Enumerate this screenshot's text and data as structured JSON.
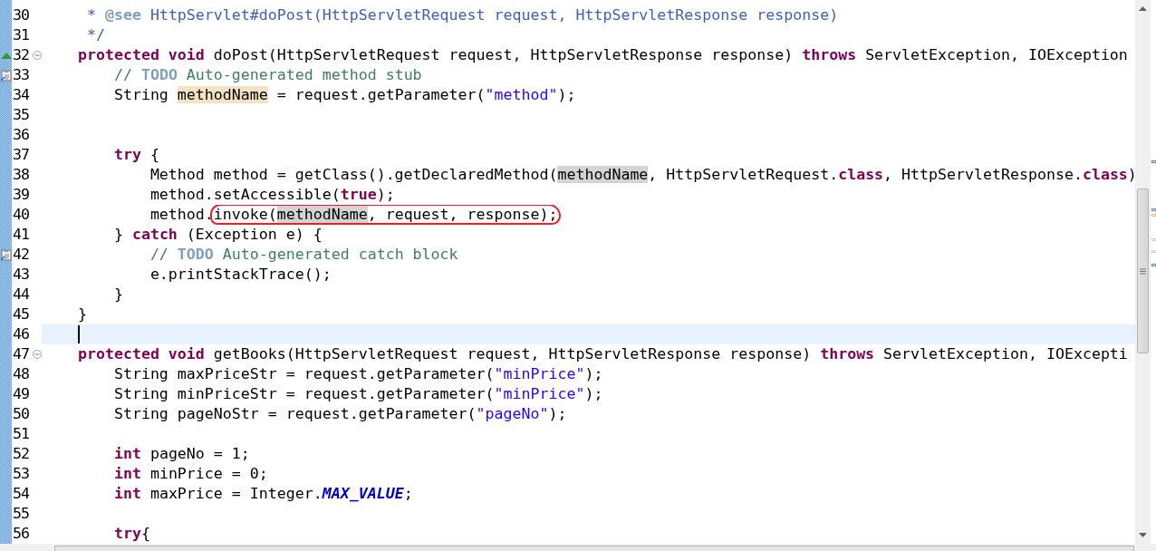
{
  "editor": {
    "lines": [
      {
        "number": "30",
        "kind": "code",
        "tokens": [
          {
            "kind": "doc",
            "text": "     * "
          },
          {
            "kind": "doctag",
            "text": "@see"
          },
          {
            "kind": "doc",
            "text": " HttpServlet#doPost(HttpServletRequest request, HttpServletResponse response)"
          }
        ]
      },
      {
        "number": "31",
        "kind": "code",
        "tokens": [
          {
            "kind": "doc",
            "text": "     */"
          }
        ]
      },
      {
        "number": "32",
        "kind": "override",
        "foldable": true,
        "tokens": [
          {
            "kind": "kw",
            "text": "    protected void"
          },
          {
            "kind": "plain",
            "text": " doPost(HttpServletRequest request, HttpServletResponse response) "
          },
          {
            "kind": "kw",
            "text": "throws"
          },
          {
            "kind": "plain",
            "text": " ServletException, IOException"
          }
        ]
      },
      {
        "number": "33",
        "kind": "task",
        "tokens": [
          {
            "kind": "comment",
            "text": "        // "
          },
          {
            "kind": "todo",
            "text": "TODO"
          },
          {
            "kind": "comment",
            "text": " Auto-generated method stub"
          }
        ]
      },
      {
        "number": "34",
        "kind": "code",
        "tokens": [
          {
            "kind": "plain",
            "text": "        String "
          },
          {
            "kind": "decl",
            "text": "methodName"
          },
          {
            "kind": "plain",
            "text": " = request.getParameter("
          },
          {
            "kind": "str",
            "text": "\"method\""
          },
          {
            "kind": "plain",
            "text": ");"
          }
        ]
      },
      {
        "number": "35",
        "kind": "code"
      },
      {
        "number": "36",
        "kind": "code"
      },
      {
        "number": "37",
        "kind": "code",
        "tokens": [
          {
            "kind": "kw",
            "text": "        try"
          },
          {
            "kind": "plain",
            "text": " {"
          }
        ]
      },
      {
        "number": "38",
        "kind": "code",
        "tokens": [
          {
            "kind": "plain",
            "text": "            Method method = getClass().getDeclaredMethod("
          },
          {
            "kind": "occ",
            "text": "methodName"
          },
          {
            "kind": "plain",
            "text": ", HttpServletRequest."
          },
          {
            "kind": "kw",
            "text": "class"
          },
          {
            "kind": "plain",
            "text": ", HttpServletResponse."
          },
          {
            "kind": "kw",
            "text": "class"
          },
          {
            "kind": "plain",
            "text": ")"
          }
        ]
      },
      {
        "number": "39",
        "kind": "code",
        "tokens": [
          {
            "kind": "plain",
            "text": "            method.setAccessible("
          },
          {
            "kind": "kw",
            "text": "true"
          },
          {
            "kind": "plain",
            "text": ");"
          }
        ]
      },
      {
        "number": "40",
        "kind": "code",
        "tokens": [
          {
            "kind": "plain",
            "text": "            method."
          },
          {
            "kind": "plain",
            "text": "invoke(",
            "circled": true
          },
          {
            "kind": "occ",
            "text": "methodName",
            "circled": true
          },
          {
            "kind": "plain",
            "text": ", request, response);",
            "circled": true
          }
        ]
      },
      {
        "number": "41",
        "kind": "code",
        "tokens": [
          {
            "kind": "plain",
            "text": "        } "
          },
          {
            "kind": "kw",
            "text": "catch"
          },
          {
            "kind": "plain",
            "text": " (Exception e) {"
          }
        ]
      },
      {
        "number": "42",
        "kind": "task",
        "tokens": [
          {
            "kind": "comment",
            "text": "            // "
          },
          {
            "kind": "todo",
            "text": "TODO"
          },
          {
            "kind": "comment",
            "text": " Auto-generated catch block"
          }
        ]
      },
      {
        "number": "43",
        "kind": "code",
        "tokens": [
          {
            "kind": "plain",
            "text": "            e.printStackTrace();"
          }
        ]
      },
      {
        "number": "44",
        "kind": "code",
        "tokens": [
          {
            "kind": "plain",
            "text": "        }"
          }
        ]
      },
      {
        "number": "45",
        "kind": "code",
        "tokens": [
          {
            "kind": "plain",
            "text": "    }"
          }
        ]
      },
      {
        "number": "46",
        "kind": "code",
        "current": true
      },
      {
        "number": "47",
        "kind": "code",
        "foldable": true,
        "tokens": [
          {
            "kind": "kw",
            "text": "    protected void"
          },
          {
            "kind": "plain",
            "text": " getBooks(HttpServletRequest request, HttpServletResponse response) "
          },
          {
            "kind": "kw",
            "text": "throws"
          },
          {
            "kind": "plain",
            "text": " ServletException, IOExcepti"
          }
        ]
      },
      {
        "number": "48",
        "kind": "code",
        "tokens": [
          {
            "kind": "plain",
            "text": "        String maxPriceStr = request.getParameter("
          },
          {
            "kind": "str",
            "text": "\"minPrice\""
          },
          {
            "kind": "plain",
            "text": ");"
          }
        ]
      },
      {
        "number": "49",
        "kind": "code",
        "tokens": [
          {
            "kind": "plain",
            "text": "        String minPriceStr = request.getParameter("
          },
          {
            "kind": "str",
            "text": "\"minPrice\""
          },
          {
            "kind": "plain",
            "text": ");"
          }
        ]
      },
      {
        "number": "50",
        "kind": "code",
        "tokens": [
          {
            "kind": "plain",
            "text": "        String pageNoStr = request.getParameter("
          },
          {
            "kind": "str",
            "text": "\"pageNo\""
          },
          {
            "kind": "plain",
            "text": ");"
          }
        ]
      },
      {
        "number": "51",
        "kind": "code"
      },
      {
        "number": "52",
        "kind": "code",
        "tokens": [
          {
            "kind": "kw",
            "text": "        int"
          },
          {
            "kind": "plain",
            "text": " pageNo = 1;"
          }
        ]
      },
      {
        "number": "53",
        "kind": "code",
        "tokens": [
          {
            "kind": "kw",
            "text": "        int"
          },
          {
            "kind": "plain",
            "text": " minPrice = 0;"
          }
        ]
      },
      {
        "number": "54",
        "kind": "code",
        "tokens": [
          {
            "kind": "kw",
            "text": "        int"
          },
          {
            "kind": "plain",
            "text": " maxPrice = Integer."
          },
          {
            "kind": "const",
            "text": "MAX_VALUE"
          },
          {
            "kind": "plain",
            "text": ";"
          }
        ]
      },
      {
        "number": "55",
        "kind": "code"
      },
      {
        "number": "56",
        "kind": "code",
        "tokens": [
          {
            "kind": "kw",
            "text": "        try"
          },
          {
            "kind": "plain",
            "text": "{"
          }
        ]
      }
    ]
  }
}
